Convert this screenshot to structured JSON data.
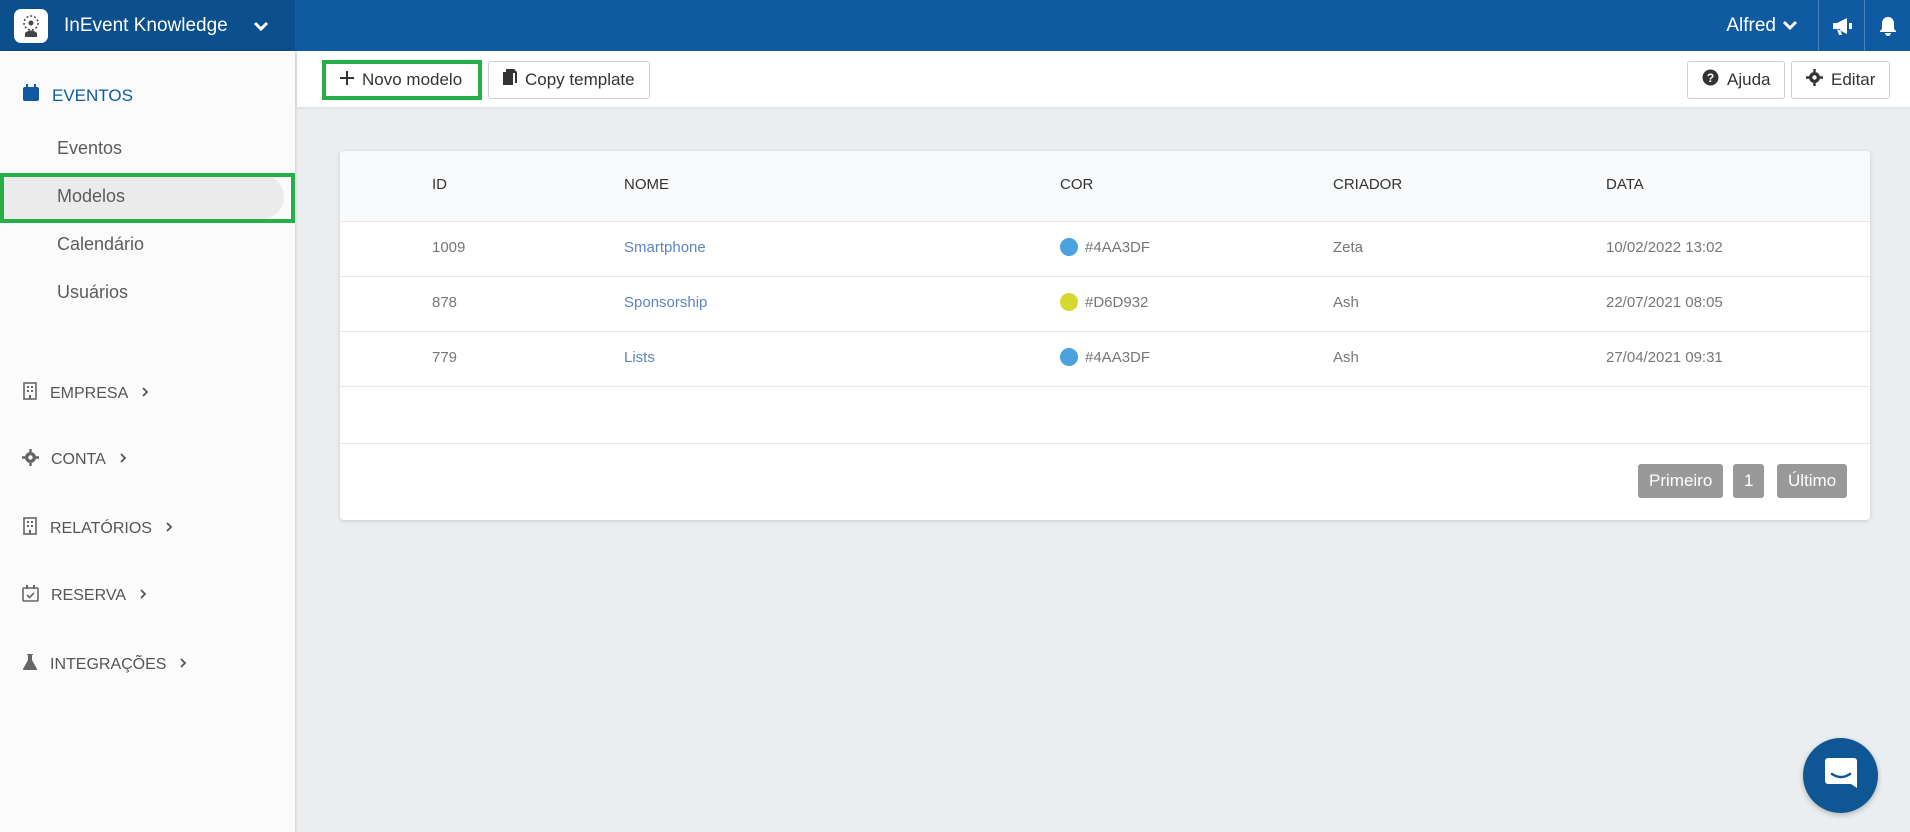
{
  "topbar": {
    "brand_name": "InEvent Knowledge",
    "user_name": "Alfred",
    "colors": {
      "bar": "#0f5aa0",
      "brand_bg": "#0b4f8c"
    }
  },
  "sidebar": {
    "active_section": "EVENTOS",
    "event_items": [
      "Eventos",
      "Modelos",
      "Calendário",
      "Usuários"
    ],
    "selected_item": "Modelos",
    "sections": [
      {
        "label": "EMPRESA",
        "icon": "building-icon"
      },
      {
        "label": "CONTA",
        "icon": "gear-icon"
      },
      {
        "label": "RELATÓRIOS",
        "icon": "building-icon"
      },
      {
        "label": "RESERVA",
        "icon": "calendar-check-icon"
      },
      {
        "label": "INTEGRAÇÕES",
        "icon": "flask-icon"
      }
    ]
  },
  "toolbar": {
    "new_model": "Novo modelo",
    "copy_template": "Copy template",
    "help": "Ajuda",
    "edit": "Editar"
  },
  "table": {
    "headers": [
      "ID",
      "NOME",
      "COR",
      "CRIADOR",
      "DATA"
    ],
    "rows": [
      {
        "id": "1009",
        "name": "Smartphone",
        "color": "#4AA3DF",
        "creator": "Zeta",
        "date": "10/02/2022 13:02"
      },
      {
        "id": "878",
        "name": "Sponsorship",
        "color": "#D6D932",
        "creator": "Ash",
        "date": "22/07/2021 08:05"
      },
      {
        "id": "779",
        "name": "Lists",
        "color": "#4AA3DF",
        "creator": "Ash",
        "date": "27/04/2021 09:31"
      }
    ]
  },
  "pagination": {
    "first": "Primeiro",
    "page": "1",
    "last": "Último"
  },
  "highlight_color": "#27ae4a"
}
